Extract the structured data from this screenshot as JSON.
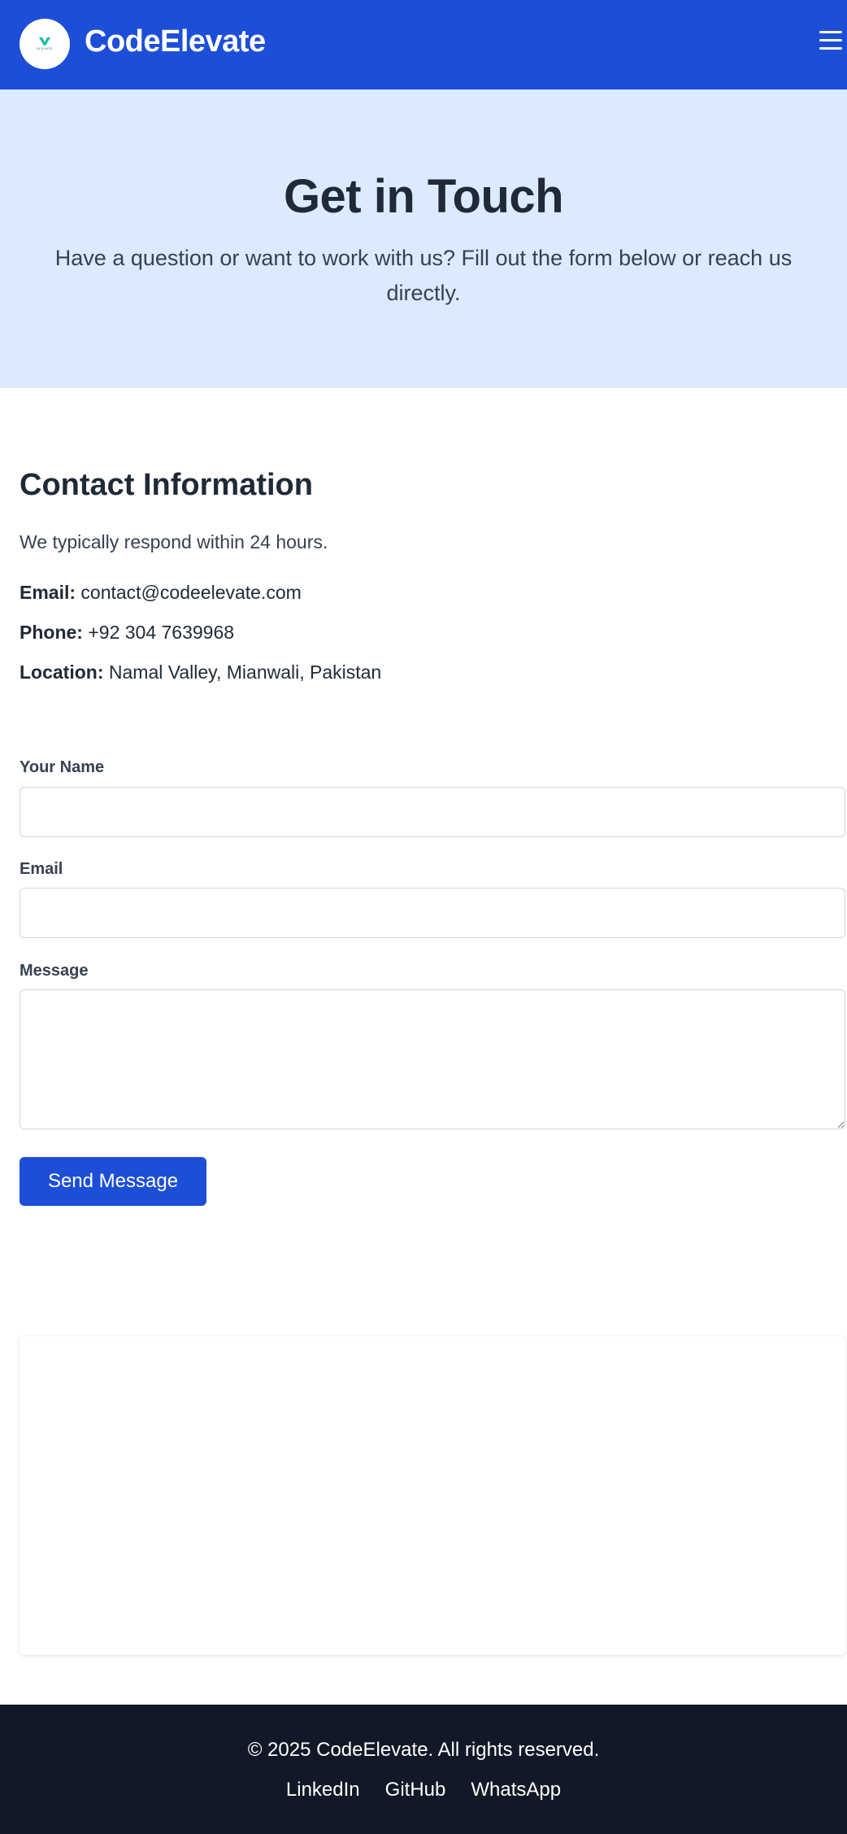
{
  "header": {
    "logo_text": "ELEVATE",
    "brand": "CodeElevate",
    "menu_icon": "hamburger-menu-icon",
    "colors": {
      "navbar": "#1d4ed8",
      "logo_accent": "#14b8a6"
    }
  },
  "hero": {
    "title": "Get in Touch",
    "subtitle": "Have a question or want to work with us? Fill out the form below or reach us directly.",
    "background": "#dbeafe"
  },
  "contact_info": {
    "heading": "Contact Information",
    "respond_text": "We typically respond within 24 hours.",
    "email_label": "Email:",
    "email_value": "contact@codeelevate.com",
    "phone_label": "Phone:",
    "phone_value": "+92 304 7639968",
    "location_label": "Location:",
    "location_value": "Namal Valley, Mianwali, Pakistan"
  },
  "form": {
    "name_label": "Your Name",
    "name_value": "",
    "email_label": "Email",
    "email_value": "",
    "message_label": "Message",
    "message_value": "",
    "submit_label": "Send Message",
    "button_color": "#1d4ed8"
  },
  "footer": {
    "copyright": "© 2025 CodeElevate. All rights reserved.",
    "links": [
      "LinkedIn",
      "GitHub",
      "WhatsApp"
    ],
    "background": "#111827"
  }
}
